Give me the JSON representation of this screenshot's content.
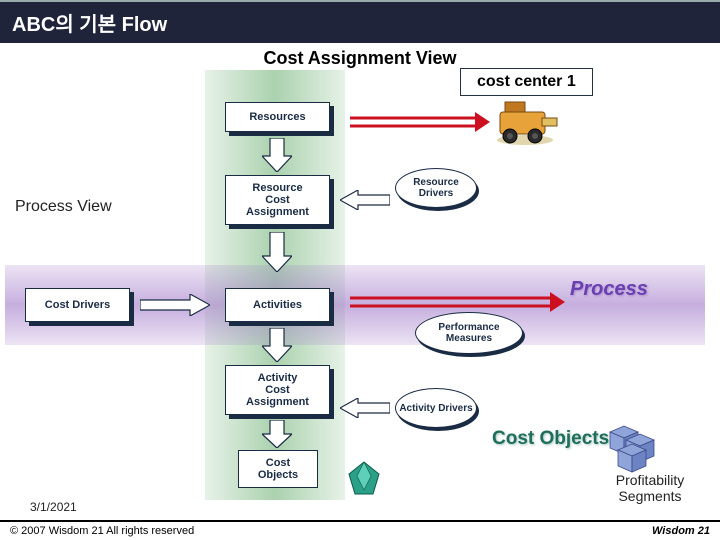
{
  "title": "ABC의 기본 Flow",
  "subtitle": "Cost Assignment View",
  "cost_center": "cost center 1",
  "process_view": "Process View",
  "process": "Process",
  "cost_objects_label": "Cost Objects",
  "profitability": "Profitability\nSegments",
  "date": "3/1/2021",
  "boxes": {
    "resources": "Resources",
    "rca": "Resource\nCost\nAssignment",
    "cost_drivers": "Cost Drivers",
    "activities": "Activities",
    "aca": "Activity\nCost\nAssignment",
    "cost_objects": "Cost\nObjects"
  },
  "clouds": {
    "resource_drivers": "Resource\nDrivers",
    "perf_measures": "Performance\nMeasures",
    "activity_drivers": "Activity\nDrivers"
  },
  "footer": {
    "left": "© 2007 Wisdom 21 All rights reserved",
    "right": "Wisdom 21"
  }
}
